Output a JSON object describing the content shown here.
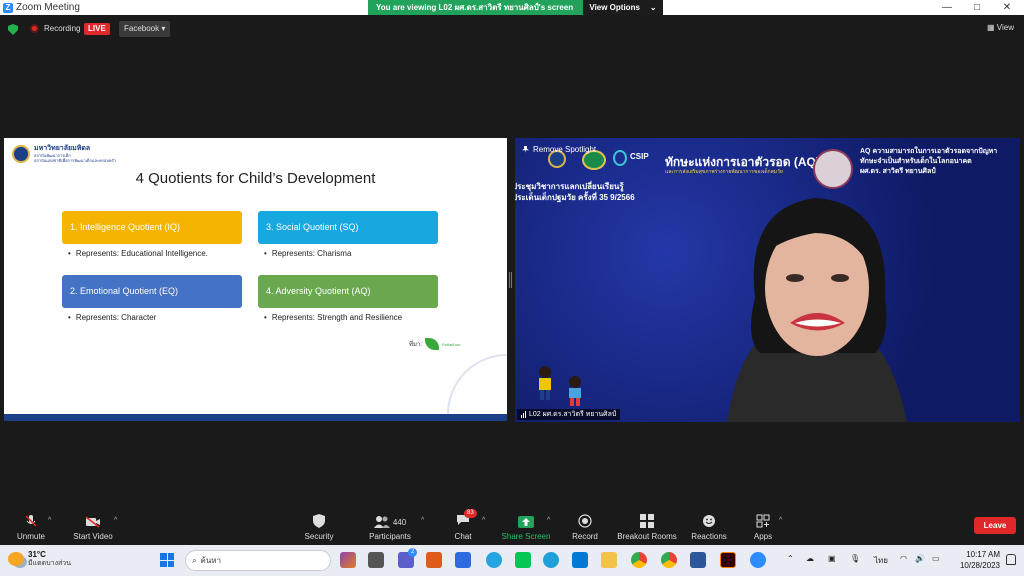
{
  "window": {
    "title": "Zoom Meeting",
    "controls": [
      "—",
      "□",
      "✕"
    ]
  },
  "share_banner": {
    "text": "You are viewing L02 ผศ.ดร.สาวิตรี ทยานศิลป์'s screen",
    "view_options": "View Options"
  },
  "meeting_bar": {
    "recording": "Recording",
    "live": "LIVE",
    "stream": "Facebook",
    "view": "View"
  },
  "slide": {
    "university": "มหาวิทยาลัยมหิดล",
    "university_sub1": "สถาบันพัฒนาการเด็ก",
    "university_sub2": "สถาบันแห่งชาติเพื่อการพัฒนาเด็กและครอบครัว",
    "title": "4 Quotients for Child’s Development",
    "quotients": [
      {
        "label": "1. Intelligence Quotient (IQ)",
        "desc": "Represents: Educational  Intelligence.",
        "color": "#f5b400"
      },
      {
        "label": "3. Social Quotient (SQ)",
        "desc": "Represents: Charisma",
        "color": "#17a8e0"
      },
      {
        "label": "2. Emotional Quotient (EQ)",
        "desc": "Represents: Character",
        "color": "#4472c4"
      },
      {
        "label": "4. Adversity Quotient (AQ)",
        "desc": "Represents: Strength and Resilience",
        "color": "#6aa84f"
      }
    ],
    "source_label": "ที่มา:",
    "source_logo": "RotlaiKum"
  },
  "video": {
    "remove_spotlight": "Remove Spotlight",
    "csip": "CSIP",
    "header_title": "ทักษะแห่งการเอาตัวรอด (AQ)",
    "header_sub": "และการส่งเสริมสุขภาพร่างกายพัฒนาการของเด็กสมวัย",
    "right_title1": "AQ ความสามารถในการเอาตัวรอดจากปัญหา",
    "right_title2": "ทักษะจำเป็นสำหรับเด็กในโลกอนาคต",
    "right_name": "ผศ.ดร. สาวิตรี ทยานศิลป์",
    "conference1": "ประชุมวิชาการแลกเปลี่ยนเรียนรู้",
    "conference2": "ประเด็นเด็กปฐมวัย ครั้งที่ 35  9/2566",
    "name_tag": "L02 ผศ.ดร.สาวิตรี ทยานศิลป์"
  },
  "toolbar": {
    "unmute": "Unmute",
    "start_video": "Start Video",
    "security": "Security",
    "participants": "Participants",
    "participants_count": "440",
    "chat": "Chat",
    "chat_badge": "83",
    "share_screen": "Share Screen",
    "record": "Record",
    "breakout_rooms": "Breakout Rooms",
    "reactions": "Reactions",
    "apps": "Apps",
    "leave": "Leave"
  },
  "taskbar": {
    "temperature": "31°C",
    "condition": "มีแดดบางส่วน",
    "search_placeholder": "ค้นหา",
    "teams_badge": "2",
    "language": "ไทย",
    "time": "10:17 AM",
    "date": "10/28/2023"
  },
  "colors": {
    "zoom_blue": "#2d8cff",
    "share_green": "#21a35b",
    "leave_red": "#e02828",
    "slide_navy": "#1d3f87"
  }
}
